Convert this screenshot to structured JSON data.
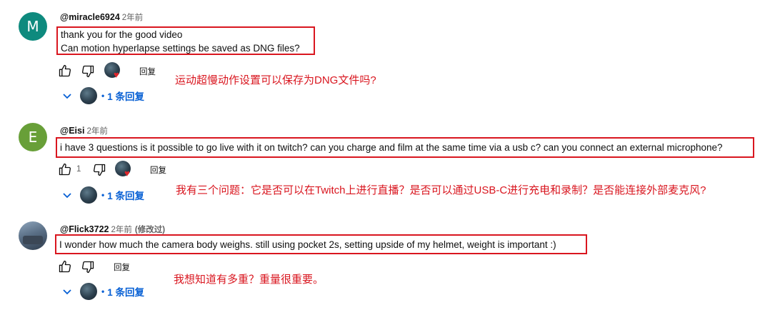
{
  "comments": [
    {
      "avatar_letter": "M",
      "avatar_color": "#0e8a7e",
      "handle": "@miracle6924",
      "time": "2年前",
      "lines": [
        "thank you for the good video",
        "Can motion hyperlapse settings be saved as DNG files?"
      ],
      "like_count": "",
      "reply_label": "回复",
      "replies_label": "1 条回复",
      "replies_bullet": "•",
      "translation": "运动超慢动作设置可以保存为DNG文件吗?"
    },
    {
      "avatar_letter": "E",
      "avatar_color": "#689f38",
      "handle": "@Eisi",
      "time": "2年前",
      "lines": [
        "i have 3 questions is it possible to go live with it on twitch? can you charge and film at the same time via a usb c? can you connect an external microphone?"
      ],
      "like_count": "1",
      "reply_label": "回复",
      "replies_label": "1 条回复",
      "replies_bullet": "•",
      "translation": "我有三个问题：它是否可以在Twitch上进行直播？是否可以通过USB-C进行充电和录制？是否能连接外部麦克风?"
    },
    {
      "avatar_letter": "",
      "avatar_color": "#5a6f86",
      "handle": "@Flick3722",
      "time": "2年前",
      "edited": "(修改过)",
      "lines": [
        "I wonder how much the camera body weighs. still using pocket 2s, setting upside of my helmet, weight is important :)"
      ],
      "like_count": "",
      "reply_label": "回复",
      "replies_label": "1 条回复",
      "replies_bullet": "•",
      "translation": "我想知道有多重？重量很重要。"
    }
  ],
  "icons": {
    "like": "thumbs-up-icon",
    "dislike": "thumbs-down-icon",
    "expand": "chevron-down-icon",
    "creator_heart": "heart-icon"
  },
  "colors": {
    "highlight_box": "#d9161f",
    "translation_text": "#d9161f",
    "link_blue": "#065fd4"
  }
}
